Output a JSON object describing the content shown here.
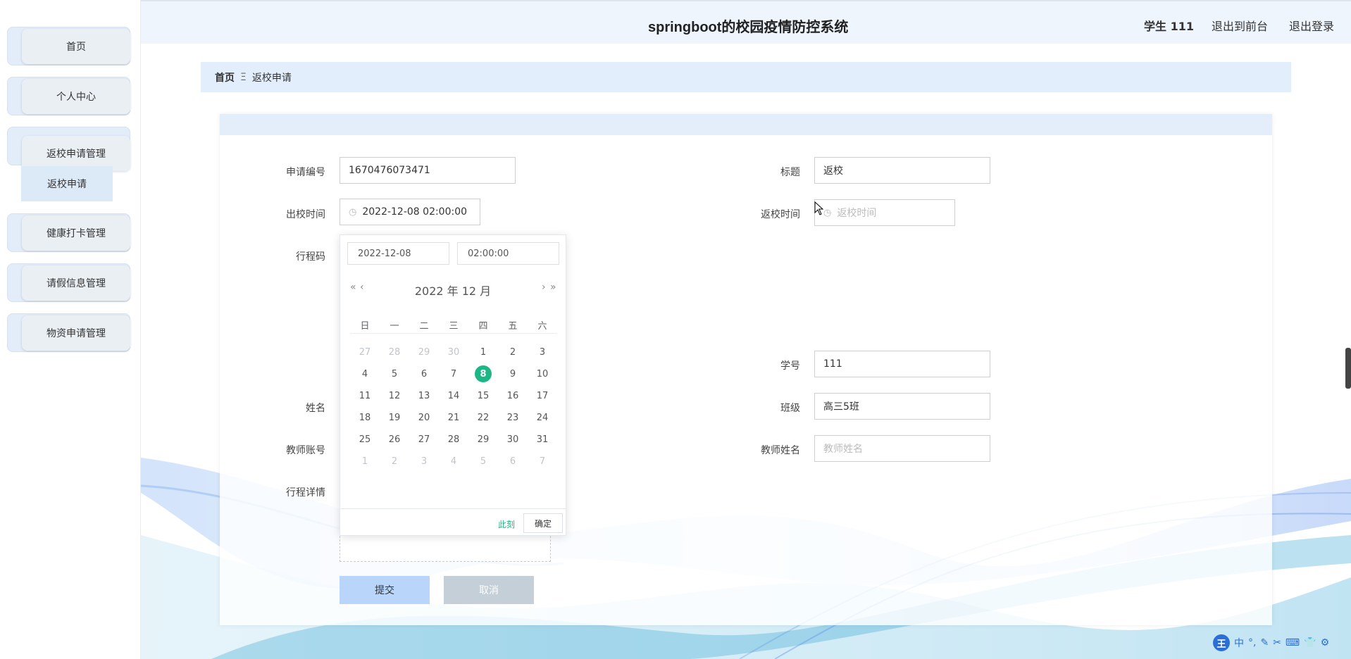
{
  "header": {
    "title": "springboot的校园疫情防控系统",
    "user": "学生 111",
    "back_to_front": "退出到前台",
    "logout": "退出登录"
  },
  "sidebar": {
    "items": [
      {
        "label": "首页"
      },
      {
        "label": "个人中心"
      },
      {
        "label": "返校申请管理"
      },
      {
        "label": "健康打卡管理"
      },
      {
        "label": "请假信息管理"
      },
      {
        "label": "物资申请管理"
      }
    ],
    "submenu": {
      "label": "返校申请"
    }
  },
  "breadcrumb": {
    "home": "首页",
    "separator": "Ξ",
    "current": "返校申请"
  },
  "form": {
    "apply_no": {
      "label": "申请编号",
      "value": "1670476073471"
    },
    "title": {
      "label": "标题",
      "value": "返校"
    },
    "leave_time": {
      "label": "出校时间",
      "value": "2022-12-08 02:00:00"
    },
    "return_time": {
      "label": "返校时间",
      "placeholder": "返校时间"
    },
    "trip_code": {
      "label": "行程码"
    },
    "student_no": {
      "label": "学号",
      "value": "111"
    },
    "name": {
      "label": "姓名"
    },
    "class": {
      "label": "班级",
      "value": "高三5班"
    },
    "teacher_account": {
      "label": "教师账号"
    },
    "teacher_name": {
      "label": "教师姓名",
      "placeholder": "教师姓名"
    },
    "trip_detail": {
      "label": "行程详情"
    },
    "submit": "提交",
    "cancel": "取消"
  },
  "datepicker": {
    "date_value": "2022-12-08",
    "time_value": "02:00:00",
    "title": "2022 年  12 月",
    "prev_year": "«",
    "prev_month": "‹",
    "next_month": "›",
    "next_year": "»",
    "weekdays": [
      "日",
      "一",
      "二",
      "三",
      "四",
      "五",
      "六"
    ],
    "weeks": [
      [
        {
          "d": "27",
          "o": true
        },
        {
          "d": "28",
          "o": true
        },
        {
          "d": "29",
          "o": true
        },
        {
          "d": "30",
          "o": true
        },
        {
          "d": "1"
        },
        {
          "d": "2"
        },
        {
          "d": "3"
        }
      ],
      [
        {
          "d": "4"
        },
        {
          "d": "5"
        },
        {
          "d": "6"
        },
        {
          "d": "7"
        },
        {
          "d": "8",
          "s": true
        },
        {
          "d": "9"
        },
        {
          "d": "10"
        }
      ],
      [
        {
          "d": "11"
        },
        {
          "d": "12"
        },
        {
          "d": "13"
        },
        {
          "d": "14"
        },
        {
          "d": "15"
        },
        {
          "d": "16"
        },
        {
          "d": "17"
        }
      ],
      [
        {
          "d": "18"
        },
        {
          "d": "19"
        },
        {
          "d": "20"
        },
        {
          "d": "21"
        },
        {
          "d": "22"
        },
        {
          "d": "23"
        },
        {
          "d": "24"
        }
      ],
      [
        {
          "d": "25"
        },
        {
          "d": "26"
        },
        {
          "d": "27"
        },
        {
          "d": "28"
        },
        {
          "d": "29"
        },
        {
          "d": "30"
        },
        {
          "d": "31"
        }
      ],
      [
        {
          "d": "1",
          "o": true
        },
        {
          "d": "2",
          "o": true
        },
        {
          "d": "3",
          "o": true
        },
        {
          "d": "4",
          "o": true
        },
        {
          "d": "5",
          "o": true
        },
        {
          "d": "6",
          "o": true
        },
        {
          "d": "7",
          "o": true
        }
      ]
    ],
    "now": "此刻",
    "confirm": "确定"
  },
  "ime": {
    "logo": "王",
    "mode": "中",
    "icons": [
      "°,",
      "✎",
      "✂",
      "⌨",
      "👕",
      "⚙"
    ]
  },
  "colors": {
    "accent": "#1cb785",
    "header_bg": "#eef5fd",
    "breadcrumb_bg": "#e2eefb"
  }
}
